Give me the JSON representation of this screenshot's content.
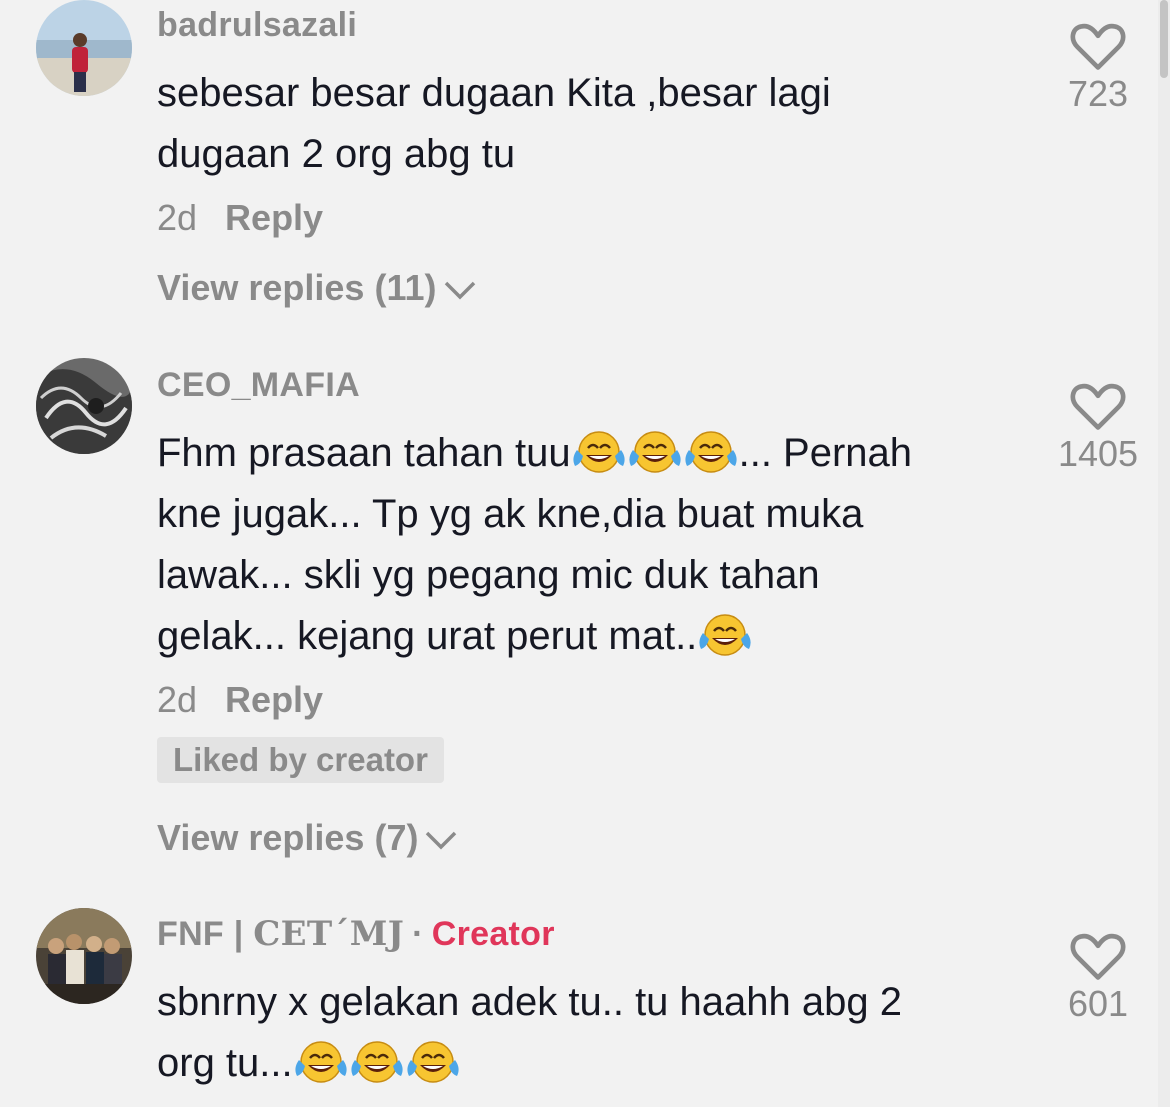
{
  "comments": [
    {
      "username": "badrulsazali",
      "text_lines": [
        "sebesar besar dugaan Kita ,besar lagi",
        "dugaan 2 org abg tu"
      ],
      "time": "2d",
      "reply_label": "Reply",
      "view_replies": "View replies (11)",
      "likes": "723"
    },
    {
      "username": "CEO_MAFIA",
      "text_line1_a": "Fhm prasaan tahan tuu",
      "text_line1_b": "... Pernah",
      "text_line2": "kne jugak... Tp yg ak kne,dia buat muka",
      "text_line3": "lawak... skli yg pegang mic duk tahan",
      "text_line4": "gelak... kejang urat perut mat..",
      "time": "2d",
      "reply_label": "Reply",
      "liked_by_creator": "Liked by creator",
      "view_replies": "View replies (7)",
      "likes": "1405"
    },
    {
      "username_a": "FNF | ",
      "username_b": "CET´MJ",
      "separator": "·",
      "creator_tag": "Creator",
      "text_line1": "sbnrny x gelakan adek tu.. tu haahh abg 2",
      "text_line2": "org tu...",
      "likes": "601"
    }
  ],
  "icons": {
    "heart": "heart-outline-icon",
    "emoji": "face-with-tears-of-joy-emoji",
    "chevron": "chevron-down-icon"
  },
  "colors": {
    "background": "#f2f2f2",
    "text": "#161823",
    "muted": "#8a8a8a",
    "creator": "#e0365a"
  }
}
